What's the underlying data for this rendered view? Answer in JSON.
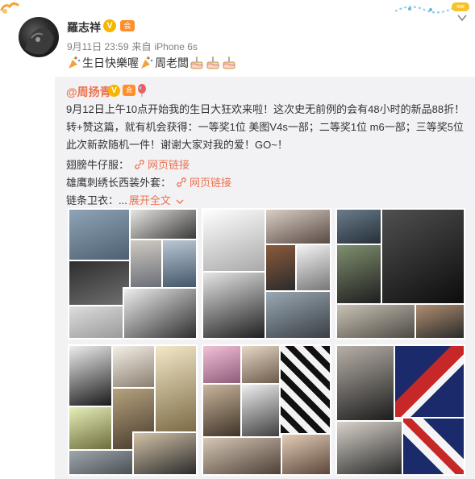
{
  "post": {
    "username": "羅志祥",
    "verified_mark": "V",
    "member_mark": "会",
    "date": "9月11日 23:59",
    "source_prefix": "来自",
    "source_device": "iPhone 6s",
    "text_part1": "生日快樂喔",
    "text_part2": "周老闆",
    "icons": [
      "party-popper-icon",
      "cake-icon",
      "chevron-down-icon"
    ]
  },
  "repost": {
    "author": "@周扬青",
    "verified_mark": "V",
    "member_mark": "会",
    "body": "9月12日上午10点开始我的生日大狂欢来啦！这次史无前例的会有48小时的新品88折！转+赞这篇，就有机会获得：一等奖1位 美图V4s一部；二等奖1位 m6一部；三等奖5位 此次新款随机一件！谢谢大家对我的爱！GO~！",
    "line1_label": "翅膀牛仔服：",
    "line2_label": "雄鹰刺绣长西装外套：",
    "line3_label": "链条卫衣：...",
    "link_text": "网页链接",
    "expand_text": "展开全文",
    "images": [
      "photo-collage-1",
      "photo-collage-2",
      "photo-collage-3",
      "photo-collage-4",
      "photo-collage-5",
      "photo-collage-6"
    ]
  },
  "colors": {
    "link": "#eb7350",
    "meta": "#808080",
    "repost_bg": "#f2f2f5",
    "verified": "#f7b500"
  }
}
